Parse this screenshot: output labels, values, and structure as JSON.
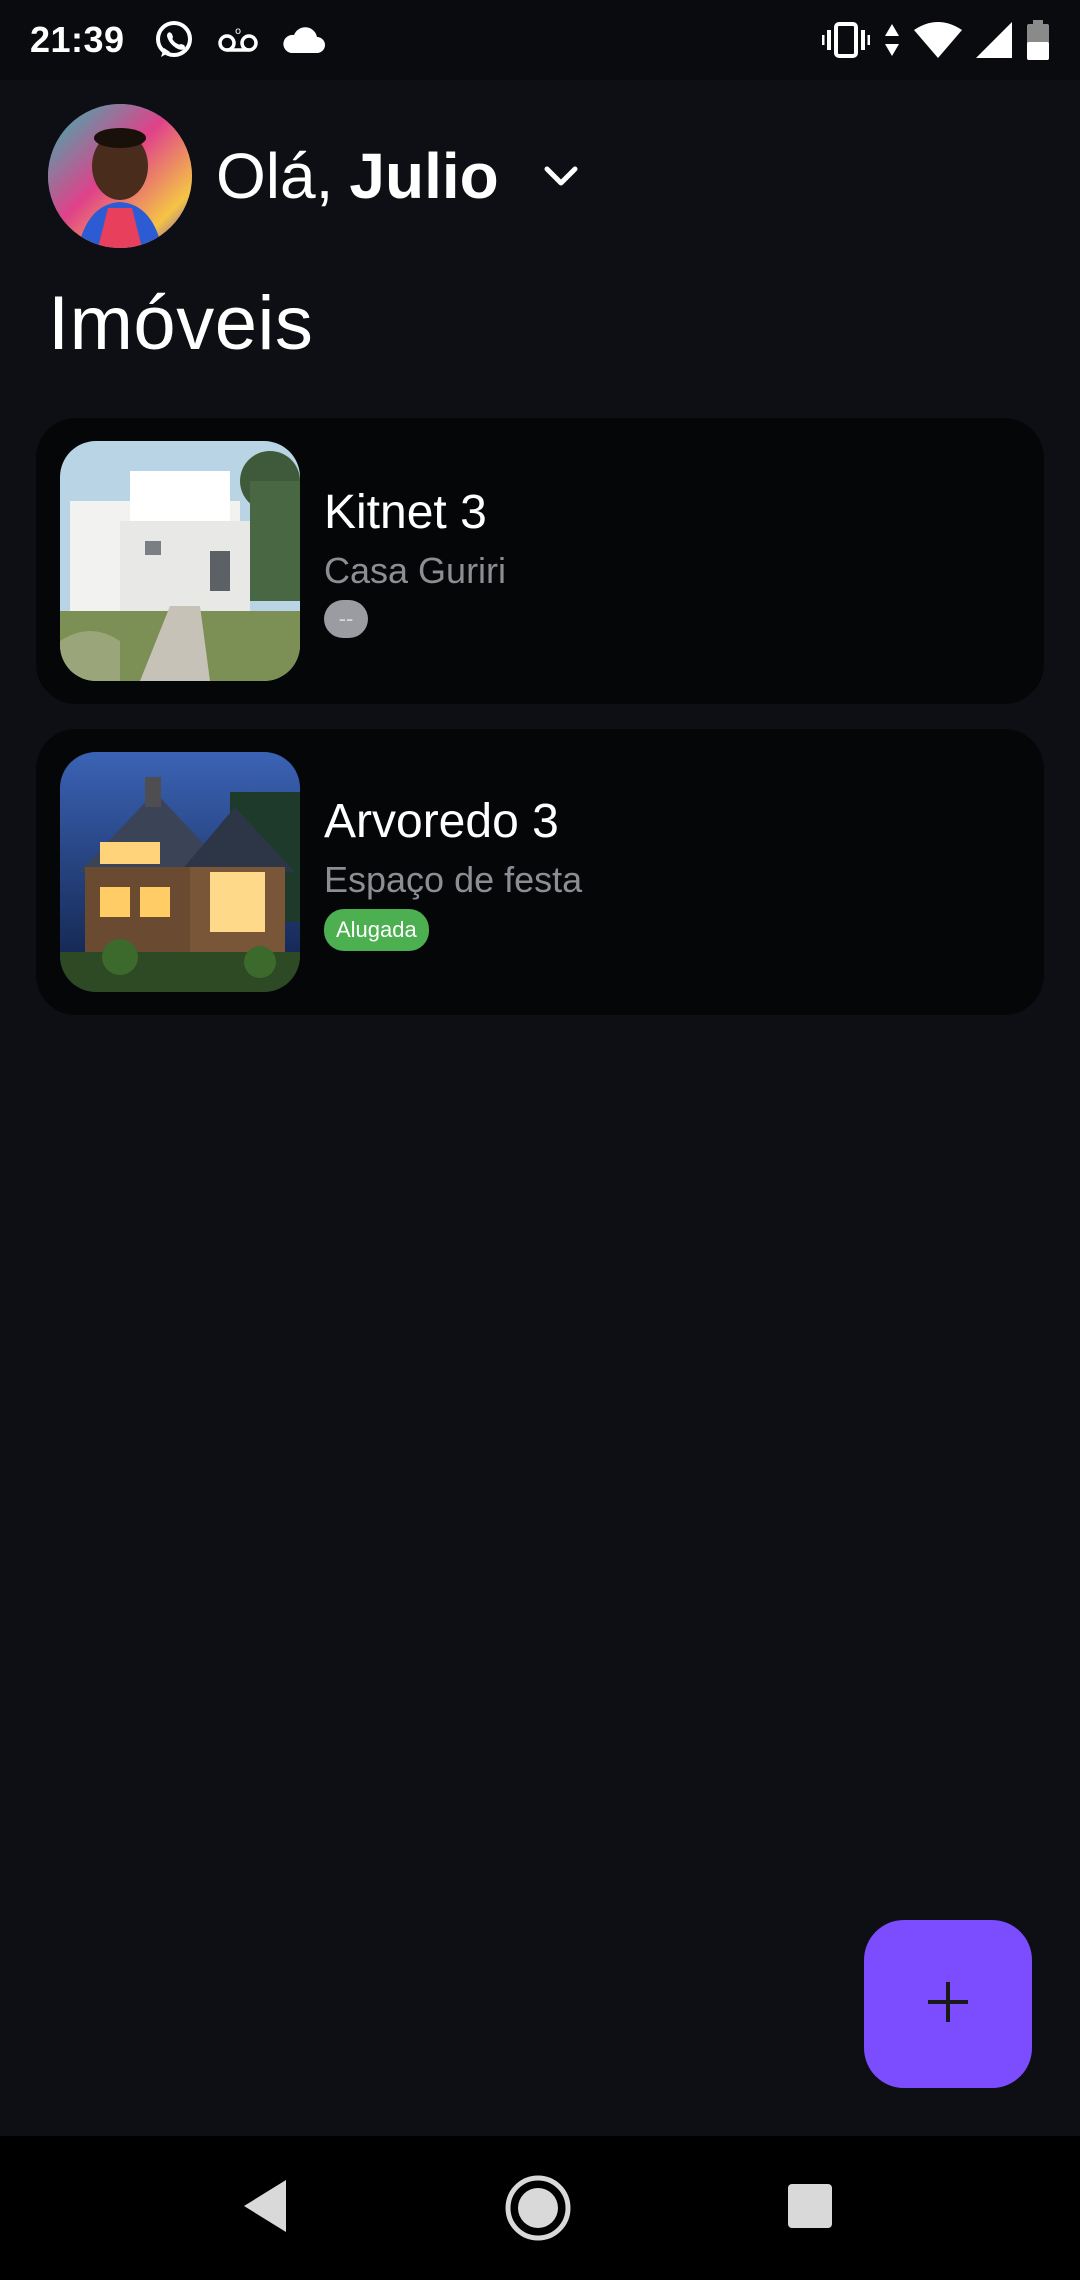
{
  "status_bar": {
    "time": "21:39",
    "left_icons": [
      "whatsapp-icon",
      "voicemail-icon",
      "cloud-icon"
    ],
    "right_icons": [
      "vibrate-icon",
      "data-arrows-icon",
      "wifi-icon",
      "signal-icon",
      "battery-icon"
    ]
  },
  "header": {
    "greeting_prefix": "Olá,",
    "user_name": "Julio"
  },
  "page": {
    "title": "Imóveis"
  },
  "properties": [
    {
      "title": "Kitnet 3",
      "subtitle": "Casa Guriri",
      "badge": "--",
      "badge_color": "#9a9ca2"
    },
    {
      "title": "Arvoredo 3",
      "subtitle": "Espaço de festa",
      "badge": "Alugada",
      "badge_color": "#4caf50"
    }
  ],
  "fab": {
    "icon": "plus-icon",
    "color": "#7c4dff"
  },
  "nav_bar": {
    "icons": [
      "back-icon",
      "home-icon",
      "recents-icon"
    ]
  }
}
